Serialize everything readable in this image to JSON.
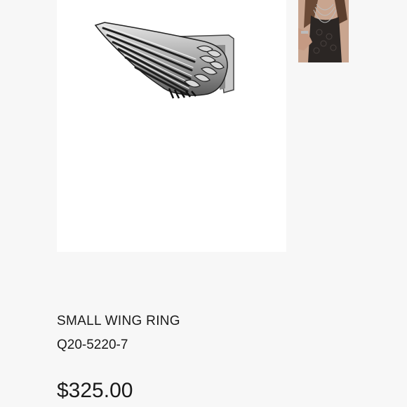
{
  "product": {
    "name": "SMALL WING RING",
    "sku": "Q20-5220-7",
    "price": "$325.00"
  },
  "images": {
    "main": "wing-ring-photo",
    "thumbnail": "model-wearing-necklaces-photo"
  },
  "colors": {
    "background": "#f7f7f7",
    "image_background": "#ffffff",
    "text": "#1a1a1a",
    "silver": "#b9b9b9",
    "shadow": "#2a2a2a"
  }
}
